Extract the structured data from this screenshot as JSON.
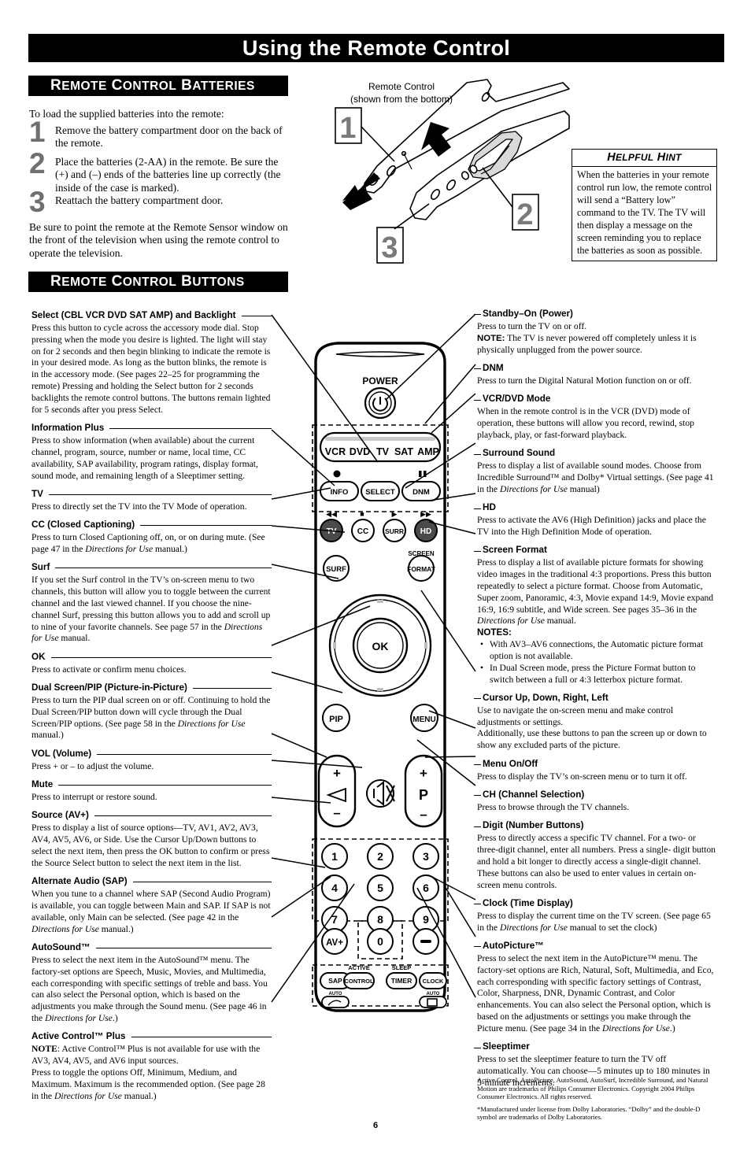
{
  "page_title": "Using the Remote Control",
  "page_number": "6",
  "sections": {
    "batteries": {
      "header_words": [
        "Remote",
        "Control",
        "Batteries"
      ],
      "intro": "To load the supplied batteries into the remote:",
      "steps": [
        {
          "num": "1",
          "text": "Remove the battery compartment door on the back of the remote."
        },
        {
          "num": "2",
          "text": "Place the batteries (2-AA) in the remote. Be sure the (+) and (–) ends of the batteries line up correctly (the inside of the case is marked)."
        },
        {
          "num": "3",
          "text": "Reattach the battery compartment door."
        }
      ],
      "outro": "Be sure to point the remote at the Remote Sensor window on the front of the television when using the remote control to operate the television."
    },
    "buttons": {
      "header_words": [
        "Remote",
        "Control",
        "Buttons"
      ]
    }
  },
  "diagram": {
    "caption_line1": "Remote Control",
    "caption_line2": "(shown from the bottom)",
    "callout_numbers": [
      "1",
      "2",
      "3"
    ]
  },
  "helpful_hint": {
    "title_words": [
      "Helpful",
      "Hint"
    ],
    "body": "When the batteries in your remote control run low, the remote control will send a “Battery low” command to the TV. The TV will then display a message on the screen reminding you to replace the batteries as soon as possible."
  },
  "left_column": [
    {
      "title": "Select (CBL VCR DVD SAT AMP) and Backlight",
      "paragraphs": [
        "Press this button to cycle across the accessory mode dial. Stop pressing when the mode you desire is lighted. The light will stay on for 2 seconds and then begin blinking to indicate the remote is in your desired mode. As long as the button blinks, the remote is in the accessory mode. (See pages 22–25 for programming the remote) Pressing and holding the Select button for 2 seconds backlights the remote control buttons. The buttons remain lighted for 5 seconds after you press Select."
      ]
    },
    {
      "title": "Information Plus",
      "paragraphs": [
        "Press to show information (when available) about the current channel, program, source, number or name, local time, CC availability, SAP availability, program ratings, display format, sound mode, and remaining length of a Sleeptimer setting."
      ]
    },
    {
      "title": "TV",
      "paragraphs": [
        "Press to directly set the TV into the TV Mode of operation."
      ]
    },
    {
      "title": "CC (Closed Captioning)",
      "paragraphs": [
        "Press to turn Closed Captioning off, on, or on during mute. (See page 47 in the <i>Directions for Use</i> manual.)"
      ]
    },
    {
      "title": "Surf",
      "paragraphs": [
        "If you set the Surf control in the TV’s on-screen menu to two channels, this button will allow you to toggle between the current channel and the last viewed channel. If you choose the nine-channel Surf, pressing this button allows you to add and scroll up to nine of your favorite channels. See page 57 in the <i>Directions for Use</i> manual."
      ]
    },
    {
      "title": "OK",
      "paragraphs": [
        "Press to activate or confirm menu choices."
      ]
    },
    {
      "title": "Dual Screen/PIP (Picture-in-Picture)",
      "paragraphs": [
        "Press to turn the PIP dual screen on or off. Continuing to hold the Dual Screen/PIP button down will cycle through the Dual Screen/PIP options. (See page 58 in the <i>Directions for Use</i> manual.)"
      ]
    },
    {
      "title": "VOL (Volume)",
      "paragraphs": [
        "Press + or – to adjust the volume."
      ]
    },
    {
      "title": "Mute",
      "paragraphs": [
        "Press to interrupt or restore sound."
      ]
    },
    {
      "title": "Source (AV+)",
      "paragraphs": [
        "Press to display a list of source options—TV, AV1, AV2, AV3, AV4, AV5, AV6, or Side.  Use the Cursor Up/Down buttons to select the next item, then press the OK button to confirm or press the Source Select button to select the next item in the list."
      ]
    },
    {
      "title": "Alternate Audio (SAP)",
      "paragraphs": [
        "When you tune to a channel where SAP (Second Audio Program) is available, you can toggle between Main and SAP. If SAP is not available, only Main can be selected. (See page 42 in the <i>Directions for Use</i> manual.)"
      ]
    },
    {
      "title": "AutoSound™",
      "paragraphs": [
        "Press to select the next item in the AutoSound™ menu. The factory-set options are Speech, Music, Movies, and Multimedia, each corresponding with specific settings of treble and bass. You can also select the Personal option, which is based on the adjustments you make through the Sound menu. (See page 46 in the <i>Directions for Use</i>.)"
      ]
    },
    {
      "title": "Active Control™ Plus",
      "paragraphs": [
        "<b>NOTE</b>: Active Control™ Plus is not available for use with the AV3, AV4, AV5, and AV6 input sources.",
        "Press to toggle the options Off, Minimum, Medium, and Maximum. Maximum is the recommended option. (See page 28 in the <i>Directions for Use</i> manual.)"
      ]
    }
  ],
  "right_column": [
    {
      "title": "Standby–On (Power)",
      "paragraphs": [
        "Press to turn the TV on or off.",
        "<b class=\"bd\">NOTE:</b> The TV is never powered off completely unless it is physically unplugged from the power source."
      ]
    },
    {
      "title": "DNM",
      "paragraphs": [
        "Press to turn the Digital Natural Motion function on or off."
      ]
    },
    {
      "title": "VCR/DVD Mode",
      "paragraphs": [
        "When in the remote control is in the VCR (DVD) mode of operation, these buttons will allow you record, rewind, stop playback, play, or fast-forward playback."
      ]
    },
    {
      "title": "Surround Sound",
      "paragraphs": [
        "Press to display a list of available sound modes. Choose from Incredible Surround™ and Dolby* Virtual settings. (See page 41 in the <i>Directions for Use</i> manual)"
      ]
    },
    {
      "title": "HD",
      "paragraphs": [
        "Press to activate the AV6 (High Definition) jacks and place the TV into the High Definition Mode of operation."
      ]
    },
    {
      "title": "Screen Format",
      "paragraphs": [
        "Press to display a list of available picture formats for showing video images in the traditional 4:3 proportions. Press this button repeatedly to select a picture format. Choose from Automatic, Super zoom, Panoramic, 4:3, Movie expand 14:9, Movie expand 16:9, 16:9 subtitle, and Wide screen. See pages 35–36 in the <i>Directions for Use</i> manual."
      ],
      "notes_label": "NOTES:",
      "notes": [
        "With AV3–AV6 connections, the Automatic picture format option is not available.",
        "In Dual Screen mode, press the Picture Format button to switch between a full or 4:3 letterbox picture format."
      ]
    },
    {
      "title": "Cursor Up, Down, Right, Left",
      "paragraphs": [
        "Use to navigate the on-screen menu and make control adjustments or settings.",
        "Additionally, use these buttons to pan the screen up or down to show any excluded parts of the picture."
      ]
    },
    {
      "title": "Menu On/Off",
      "paragraphs": [
        "Press to display the TV’s on-screen menu or to turn it off."
      ]
    },
    {
      "title": "CH (Channel Selection)",
      "paragraphs": [
        "Press to browse through the TV channels."
      ]
    },
    {
      "title": "Digit (Number Buttons)",
      "paragraphs": [
        "Press to directly access a specific TV channel. For a two- or three-digit channel, enter all numbers. Press a single- digit button and hold a bit longer to directly access a single-digit channel. These buttons can also be used to enter values in certain on-screen menu controls."
      ]
    },
    {
      "title": "Clock (Time Display)",
      "paragraphs": [
        "Press to display the current time on the TV screen.  (See page 65 in the <i>Directions for Use</i> manual to set the clock)"
      ]
    },
    {
      "title": "AutoPicture™",
      "paragraphs": [
        "Press to select the next item in the AutoPicture™ menu. The factory-set options are Rich, Natural, Soft, Multimedia, and Eco, each corresponding with specific factory settings of Contrast, Color, Sharpness, DNR, Dynamic Contrast, and Color enhancements. You can also select the Personal option, which is based on the adjustments or settings you make through the Picture menu. (See page 34 in the <i>Directions for Use</i>.)"
      ]
    },
    {
      "title": "Sleeptimer",
      "paragraphs": [
        "Press to set the sleeptimer feature to turn the TV off automatically. You can choose—5 minutes up to 180 minutes in 5-minute increments."
      ]
    }
  ],
  "remote_labels": {
    "power": "POWER",
    "mode_dial": [
      "VCR",
      "DVD",
      "TV",
      "SAT",
      "AMP"
    ],
    "row_info": [
      "INFO",
      "SELECT",
      "DNM"
    ],
    "row_tv": [
      "TV",
      "CC",
      "SURR",
      "HD"
    ],
    "surf": "SURF",
    "screen": "SCREEN",
    "format": "FORMAT",
    "ok": "OK",
    "pip": "PIP",
    "menu": "MENU",
    "vol_plus": "+",
    "vol_minus": "–",
    "p_label": "P",
    "p_plus": "+",
    "p_minus": "–",
    "digits": [
      "1",
      "2",
      "3",
      "4",
      "5",
      "6",
      "7",
      "8",
      "9"
    ],
    "zero": "0",
    "av_plus": "AV+",
    "dash_button": "—",
    "bottom_row": [
      "SAP",
      "CONTROL",
      "TIMER",
      "CLOCK"
    ],
    "bottom_small_labels": [
      "ACTIVE",
      "SLEEP"
    ],
    "auto_labels": [
      "AUTO",
      "AUTO"
    ],
    "vcr_icons": [
      "◀◀",
      "■",
      "▶",
      "▶▶"
    ],
    "record_icon": "●",
    "pause_icon": "❙❙"
  },
  "footer_legal": [
    "Active Control, AutoPicture, AutoSound, AutoSurf, Incredible Surround, and Natural Motion are trademarks of Philips Consumer Electronics. Copyright 2004 Philips Consumer Electronics. All rights reserved.",
    "*Manufactured under license from Dolby Laboratories. “Dolby” and the double-D symbol are trademarks of Dolby Laboratories."
  ]
}
